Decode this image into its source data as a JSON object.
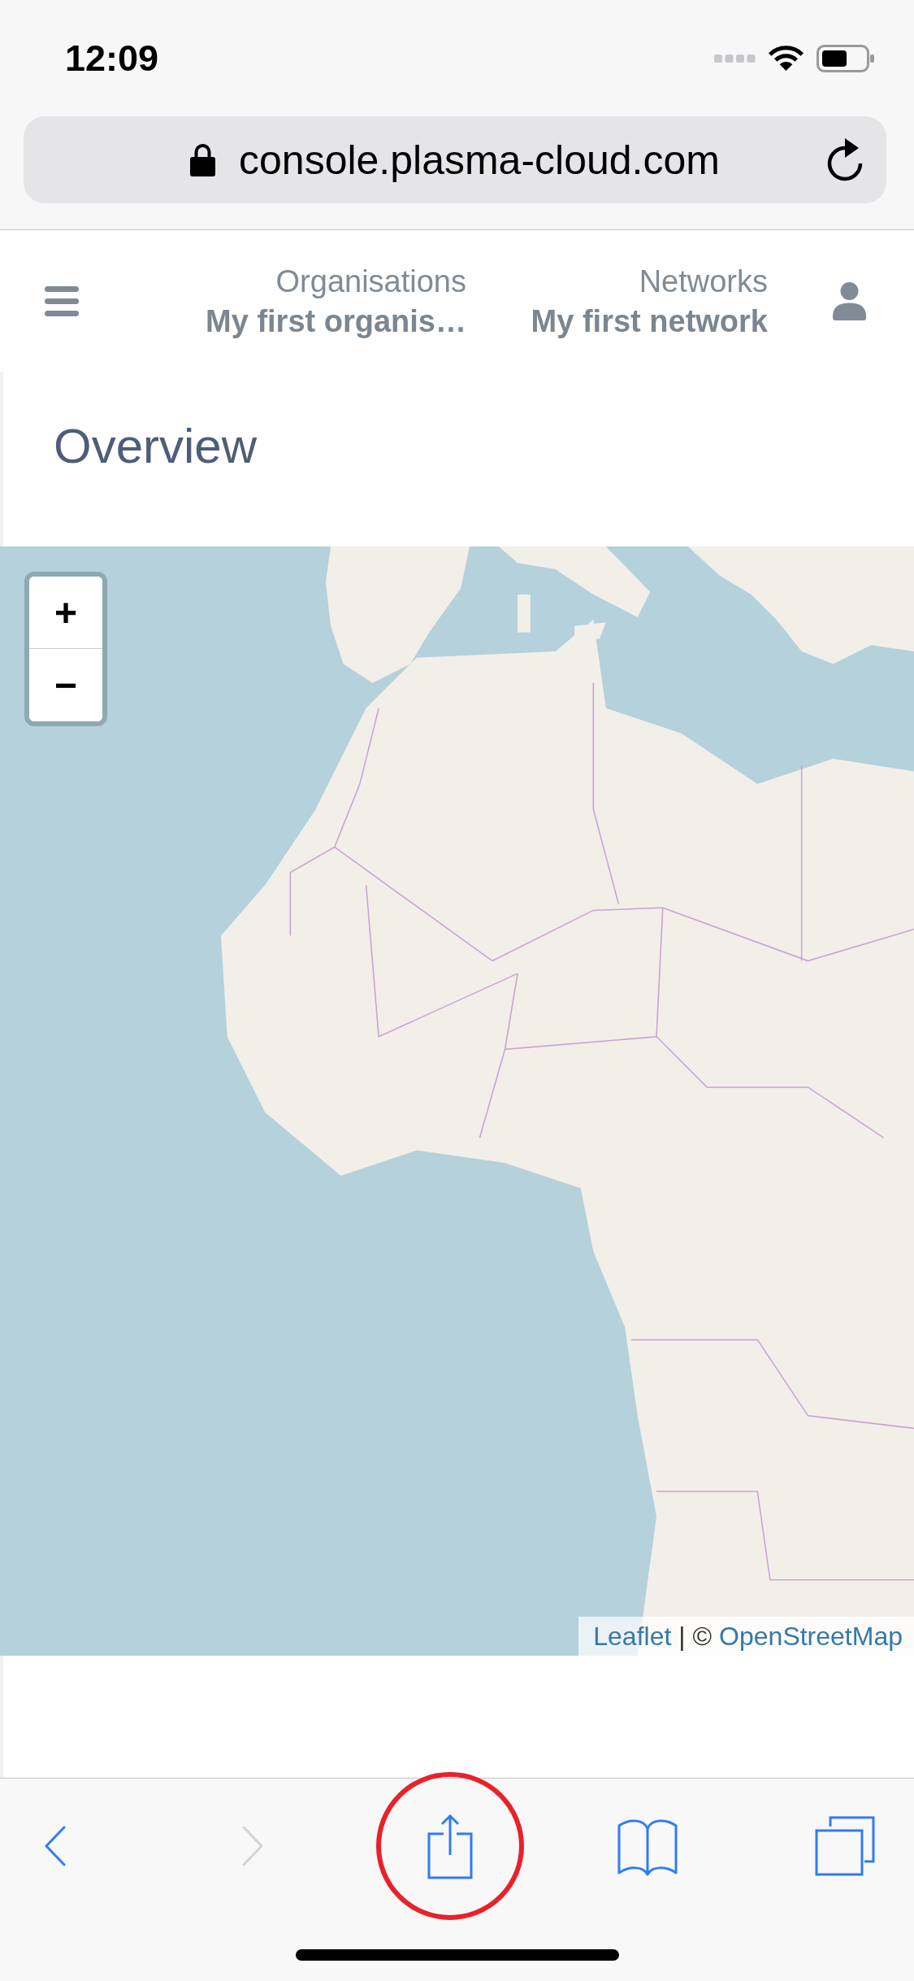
{
  "status_bar": {
    "time": "12:09"
  },
  "browser": {
    "url": "console.plasma-cloud.com",
    "secure": true
  },
  "header": {
    "selectors": [
      {
        "label": "Organisations",
        "value": "My first organis…"
      },
      {
        "label": "Networks",
        "value": "My first network"
      }
    ]
  },
  "page": {
    "title": "Overview"
  },
  "map": {
    "zoom_controls": [
      "+",
      "−"
    ],
    "attribution": [
      {
        "kind": "link",
        "text": "Leaflet"
      },
      {
        "kind": "text",
        "text": "| ©"
      },
      {
        "kind": "link",
        "text": "OpenStreetMap"
      }
    ]
  },
  "toolbar": {
    "buttons": [
      {
        "kind": "back",
        "disabled": false,
        "highlighted": false
      },
      {
        "kind": "forward",
        "disabled": true,
        "highlighted": false
      },
      {
        "kind": "share",
        "disabled": false,
        "highlighted": true
      },
      {
        "kind": "bookmarks",
        "disabled": false,
        "highlighted": false
      },
      {
        "kind": "tabs",
        "disabled": false,
        "highlighted": false
      }
    ]
  }
}
